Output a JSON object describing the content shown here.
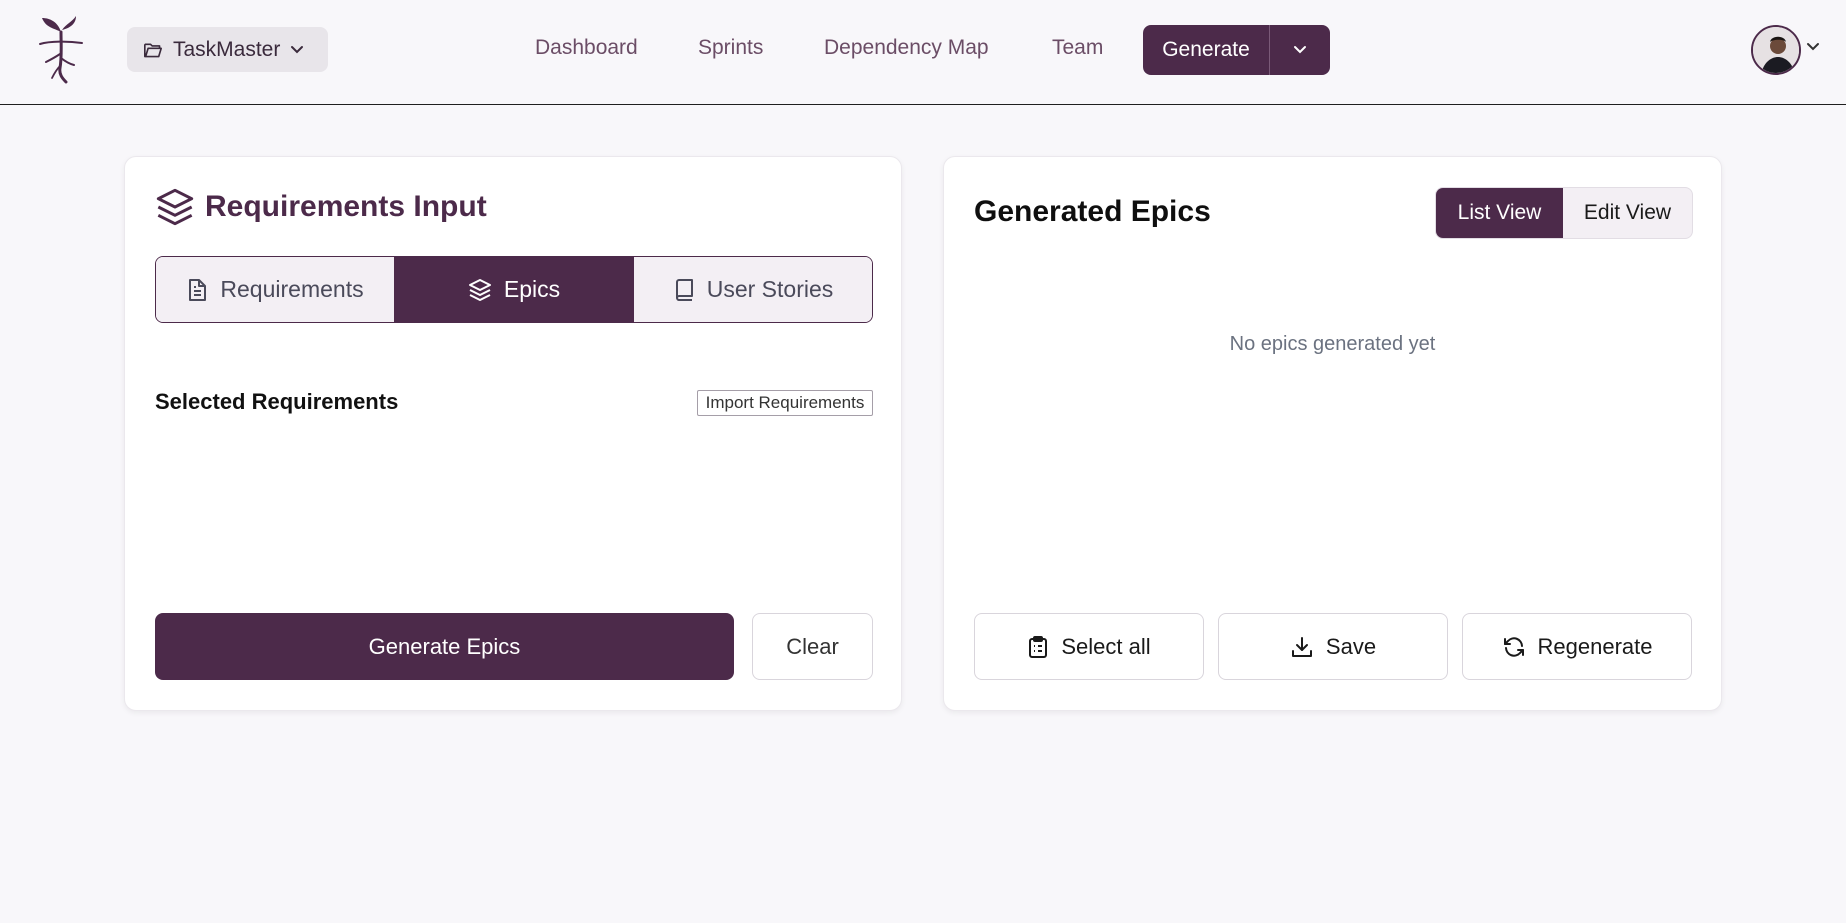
{
  "header": {
    "project": "TaskMaster",
    "nav": [
      {
        "key": "dashboard",
        "label": "Dashboard"
      },
      {
        "key": "sprints",
        "label": "Sprints"
      },
      {
        "key": "dependency-map",
        "label": "Dependency Map"
      },
      {
        "key": "team",
        "label": "Team"
      }
    ],
    "generate_label": "Generate"
  },
  "left_panel": {
    "title": "Requirements Input",
    "tabs": [
      {
        "label": "Requirements",
        "icon": "file-text-icon",
        "active": false
      },
      {
        "label": "Epics",
        "icon": "layers-icon",
        "active": true
      },
      {
        "label": "User Stories",
        "icon": "book-icon",
        "active": false
      }
    ],
    "selected_title": "Selected Requirements",
    "import_label": "Import Requirements",
    "generate_label": "Generate Epics",
    "clear_label": "Clear"
  },
  "right_panel": {
    "title": "Generated Epics",
    "view_toggle": {
      "list": "List View",
      "edit": "Edit View",
      "active": "list"
    },
    "empty_message": "No epics generated yet",
    "actions": {
      "select_all": "Select all",
      "save": "Save",
      "regenerate": "Regenerate"
    }
  },
  "colors": {
    "accent": "#4c2a4a",
    "background": "#f8f7fa",
    "muted_text": "#6b7280"
  }
}
